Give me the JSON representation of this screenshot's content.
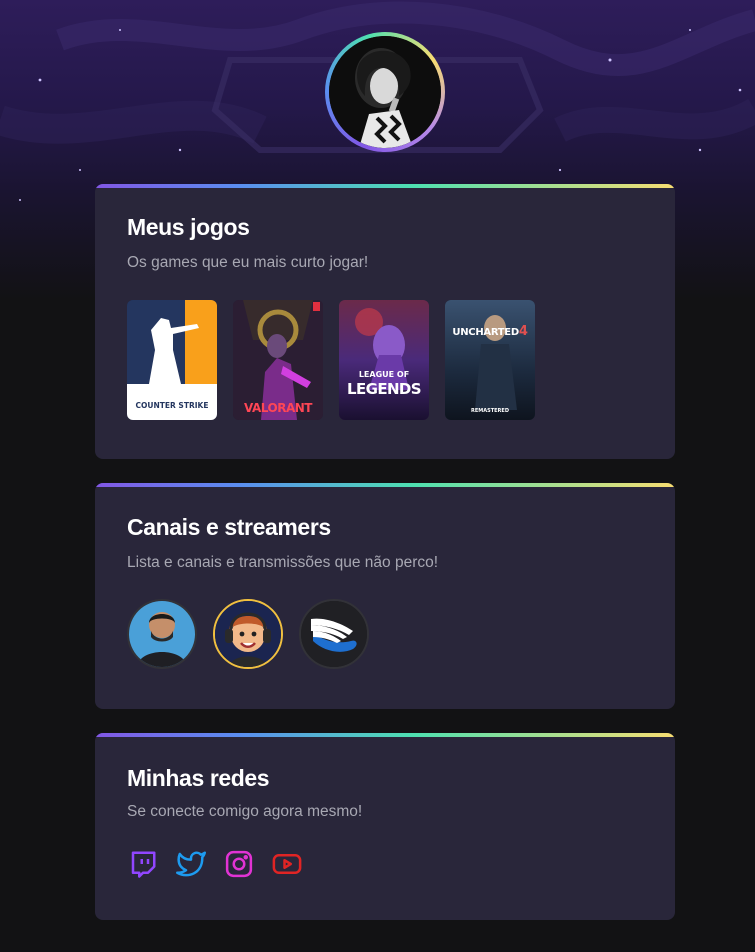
{
  "profile": {
    "avatar_alt": "foto de perfil"
  },
  "games_card": {
    "title": "Meus jogos",
    "subtitle": "Os games que eu mais curto jogar!",
    "games": [
      {
        "label_a": "COUNTER",
        "label_b": "STRIKE",
        "icon": "counter-strike-cover"
      },
      {
        "label": "VALORANT",
        "icon": "valorant-cover"
      },
      {
        "label_a": "LEAGUE OF",
        "label_b": "LEGENDS",
        "icon": "league-of-legends-cover"
      },
      {
        "label_a": "UNCHARTED",
        "label_num": "4",
        "label_b": "REMASTERED",
        "icon": "uncharted-4-cover"
      }
    ]
  },
  "channels_card": {
    "title": "Canais e streamers",
    "subtitle": "Lista e canais e transmissões que não perco!"
  },
  "social_card": {
    "title": "Minhas redes",
    "subtitle": "Se conecte comigo agora mesmo!",
    "networks": [
      {
        "name": "twitch",
        "icon": "twitch-icon",
        "color": "#9146ff"
      },
      {
        "name": "twitter",
        "icon": "twitter-icon",
        "color": "#1d9bf0"
      },
      {
        "name": "instagram",
        "icon": "instagram-icon",
        "color": "#e133d4"
      },
      {
        "name": "youtube",
        "icon": "youtube-icon",
        "color": "#e02424"
      }
    ]
  },
  "colors": {
    "page_bg": "#121214",
    "card_bg": "#29263a",
    "accent_purple": "#8257e5",
    "accent_green": "#4ee0b0",
    "accent_yellow": "#f7dd72"
  }
}
